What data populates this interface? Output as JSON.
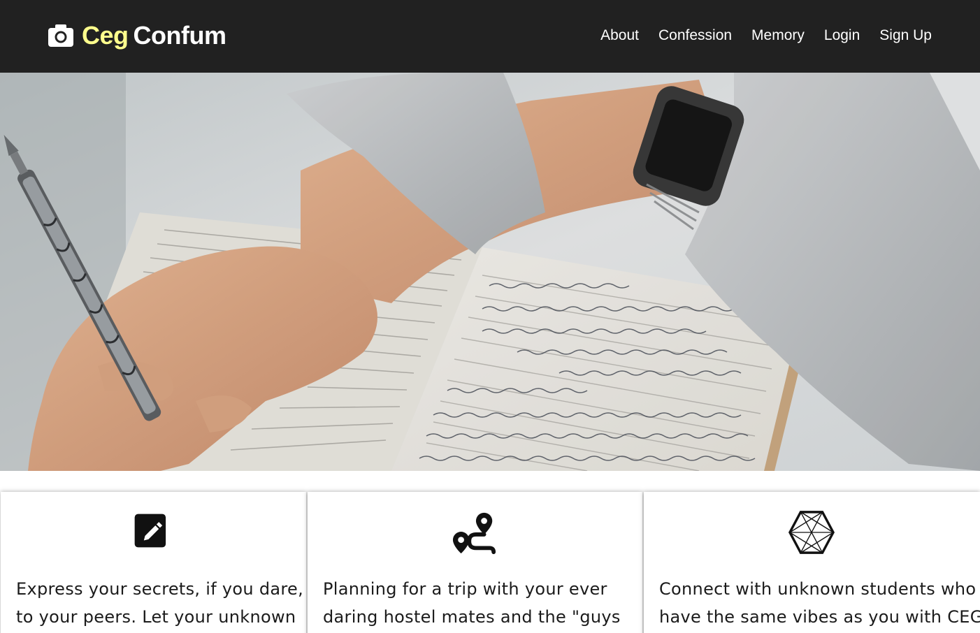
{
  "brand": {
    "icon": "camera-icon",
    "name_part1": "Ceg",
    "name_part2": "Confum",
    "accent_color": "#ffff8d"
  },
  "nav": {
    "items": [
      {
        "label": "About"
      },
      {
        "label": "Confession"
      },
      {
        "label": "Memory"
      },
      {
        "label": "Login"
      },
      {
        "label": "Sign Up"
      }
    ],
    "background_color": "#212121"
  },
  "hero": {
    "image": "person-writing-in-notebook-photo"
  },
  "cards": [
    {
      "icon": "edit-pencil-icon",
      "lines": [
        "Express your secrets, if you dare,",
        "to your peers. Let your unknown"
      ]
    },
    {
      "icon": "route-icon",
      "lines": [
        "Planning for a trip with your ever",
        "daring hostel mates and the \"guys"
      ]
    },
    {
      "icon": "network-hexagon-icon",
      "lines": [
        "Connect with unknown students who",
        "have the same vibes as you with CEG"
      ]
    }
  ]
}
